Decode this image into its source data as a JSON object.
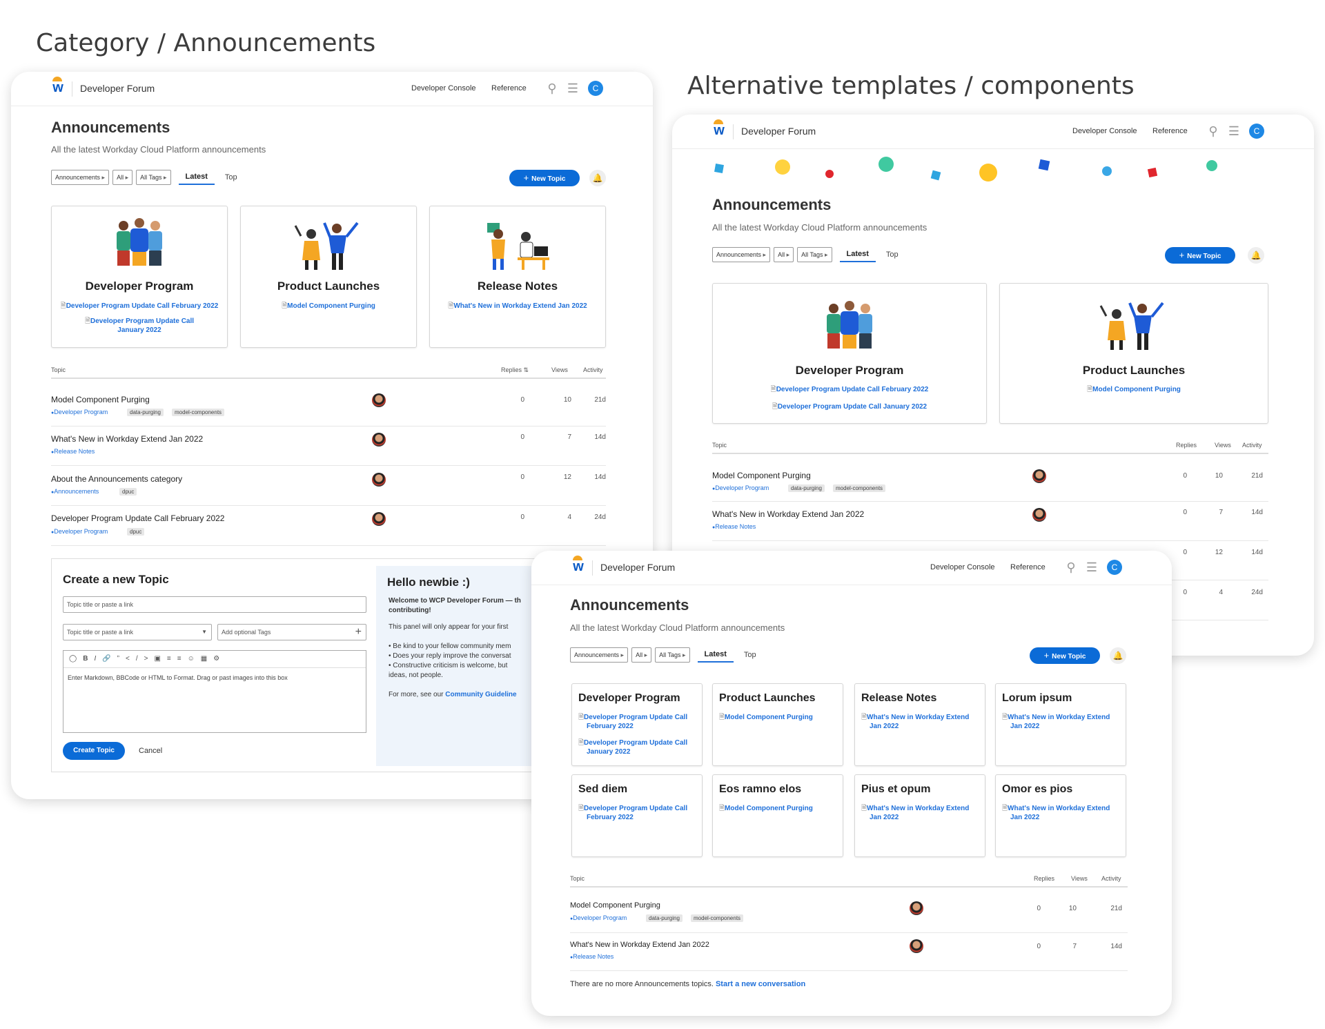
{
  "headings": {
    "left": "Category / Announcements",
    "right": "Alternative templates / components"
  },
  "nav": {
    "title": "Developer Forum",
    "link1": "Developer Console",
    "link2": "Reference",
    "avatar": "C"
  },
  "page": {
    "title": "Announcements",
    "subtitle": "All the latest Workday Cloud Platform announcements"
  },
  "filters": {
    "category": "Announcements",
    "all": "All",
    "tags": "All Tags",
    "latest": "Latest",
    "top": "Top"
  },
  "new_topic": "New Topic",
  "cards": {
    "dev": {
      "title": "Developer Program",
      "l1": "Developer Program Update Call February 2022",
      "l2": "Developer Program Update Call January 2022"
    },
    "pl": {
      "title": "Product Launches",
      "l1": "Model Component Purging"
    },
    "rn": {
      "title": "Release Notes",
      "l1": "What's New in Workday Extend Jan 2022"
    }
  },
  "table": {
    "topic": "Topic",
    "replies": "Replies",
    "views": "Views",
    "activity": "Activity"
  },
  "topics": [
    {
      "title": "Model Component Purging",
      "cat": "Developer Program",
      "tags": [
        "data-purging",
        "model-components"
      ],
      "replies": "0",
      "views": "10",
      "activity": "21d"
    },
    {
      "title": "What's New in Workday Extend Jan 2022",
      "cat": "Release Notes",
      "tags": [],
      "replies": "0",
      "views": "7",
      "activity": "14d"
    },
    {
      "title": "About the Announcements category",
      "cat": "Announcements",
      "tags": [
        "dpuc"
      ],
      "replies": "0",
      "views": "12",
      "activity": "14d"
    },
    {
      "title": "Developer Program Update Call February 2022",
      "cat": "Developer Program",
      "tags": [
        "dpuc"
      ],
      "replies": "0",
      "views": "4",
      "activity": "24d"
    }
  ],
  "composer": {
    "title": "Create a new Topic",
    "title_ph": "Topic title or paste a link",
    "cat_ph": "Topic title or paste a link",
    "tags_ph": "Add optional Tags",
    "body_ph": "Enter Markdown, BBCode or HTML to Format. Drag or past images into this box",
    "create": "Create Topic",
    "cancel": "Cancel"
  },
  "newbie": {
    "title": "Hello newbie :)",
    "welcome": "Welcome to WCP Developer Forum — th",
    "welcome2": "contributing!",
    "p1": "This panel will only appear for your first",
    "b1": "• Be kind to your fellow community mem",
    "b2": "• Does your reply improve the conversat",
    "b3": "• Constructive criticism is welcome, but",
    "b3b": "ideas, not people.",
    "more": "For more, see our",
    "more_link": "Community Guideline"
  },
  "grid": [
    {
      "title": "Developer Program",
      "l1": "Developer Program Update Call February 2022",
      "l2": "Developer Program Update Call January 2022"
    },
    {
      "title": "Product Launches",
      "l1": "Model Component Purging"
    },
    {
      "title": "Release Notes",
      "l1": "What's New in Workday Extend Jan 2022"
    },
    {
      "title": "Lorum ipsum",
      "l1": "What's New in Workday Extend Jan 2022"
    },
    {
      "title": "Sed diem",
      "l1": "Developer Program Update Call February 2022"
    },
    {
      "title": "Eos ramno elos",
      "l1": "Model Component Purging"
    },
    {
      "title": "Pius et opum",
      "l1": "What's New in Workday Extend Jan 2022"
    },
    {
      "title": "Omor es pios",
      "l1": "What's New in Workday Extend Jan 2022"
    }
  ],
  "footer": {
    "text": "There are no more Announcements topics.",
    "link": "Start a new conversation"
  }
}
